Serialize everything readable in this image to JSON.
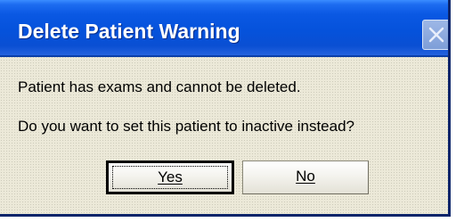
{
  "window": {
    "title": "Delete Patient Warning",
    "close_icon": "close-icon"
  },
  "message": {
    "line1": "Patient has exams and cannot be deleted.",
    "line2": "Do you want to set this patient to inactive instead?"
  },
  "buttons": {
    "yes_label": "Yes",
    "no_label": "No",
    "default": "Yes"
  },
  "colors": {
    "titlebar": "#0552db",
    "dialog_bg": "#ece9d8"
  }
}
